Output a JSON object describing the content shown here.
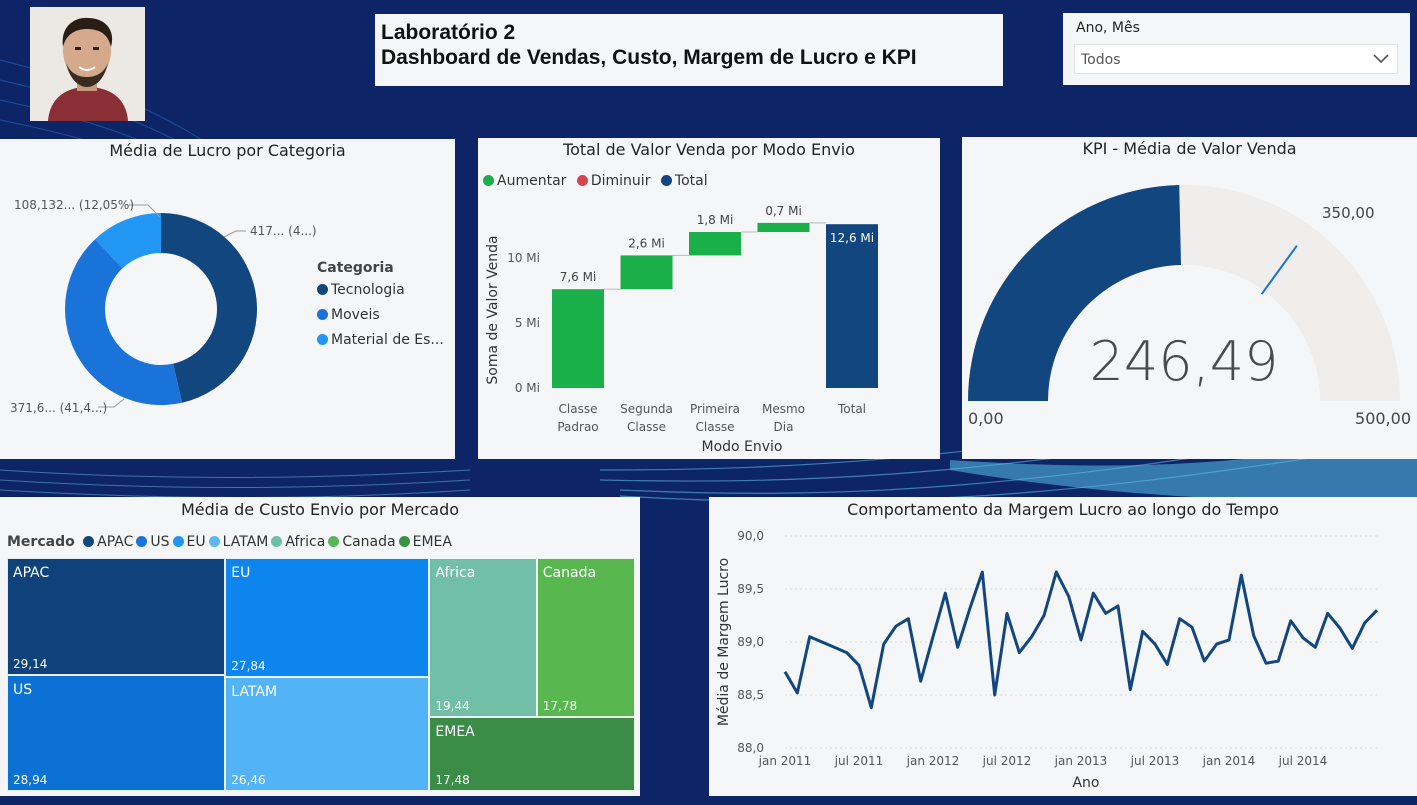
{
  "header": {
    "title_line1": "Laboratório 2",
    "title_line2": "Dashboard de Vendas, Custo, Margem de Lucro e KPI"
  },
  "slicer": {
    "label": "Ano, Mês",
    "value": "Todos",
    "icon": "chevron-down-icon"
  },
  "colors": {
    "background": "#0d2566",
    "panel": "#f5f6f8",
    "navy": "#12467e",
    "blue": "#1a73d9",
    "lightblue": "#2196f3",
    "green": "#1aaf48",
    "red": "#d64550",
    "gauge_fill": "#12467e",
    "gauge_track": "#efeeec"
  },
  "donut": {
    "title": "Média de Lucro por Categoria",
    "legend_title": "Categoria",
    "labels": [
      "108,132... (12,05%)",
      "417... (4...)",
      "371,6... (41,4...)"
    ],
    "chart_data": {
      "type": "pie",
      "title": "Média de Lucro por Categoria",
      "categories": [
        "Tecnologia",
        "Moveis",
        "Material de Es..."
      ],
      "values_percent": [
        46.5,
        41.45,
        12.05
      ],
      "colors": [
        "#12467e",
        "#1a73d9",
        "#2196f3"
      ]
    }
  },
  "waterfall": {
    "title": "Total de Valor Venda por Modo Envio",
    "legend": [
      {
        "label": "Aumentar",
        "color": "#1aaf48"
      },
      {
        "label": "Diminuir",
        "color": "#d64550"
      },
      {
        "label": "Total",
        "color": "#12467e"
      }
    ],
    "ylabel": "Soma de Valor Venda",
    "xlabel": "Modo Envio",
    "yticks": [
      "0 Mi",
      "5 Mi",
      "10 Mi"
    ],
    "chart_data": {
      "type": "bar",
      "subtype": "waterfall",
      "categories": [
        [
          "Classe",
          "Padrao"
        ],
        [
          "Segunda",
          "Classe"
        ],
        [
          "Primeira",
          "Classe"
        ],
        [
          "Mesmo",
          "Dia"
        ],
        [
          "Total"
        ]
      ],
      "values": [
        7.6,
        2.6,
        1.8,
        0.7,
        12.6
      ],
      "value_labels": [
        "7,6 Mi",
        "2,6 Mi",
        "1,8 Mi",
        "0,7 Mi",
        "12,6 Mi"
      ],
      "kinds": [
        "increase",
        "increase",
        "increase",
        "increase",
        "total"
      ],
      "ylim": [
        0,
        13.5
      ],
      "unit": "Mi"
    }
  },
  "gauge": {
    "title": "KPI - Média de Valor Venda",
    "value_text": "246,49",
    "min_text": "0,00",
    "max_text": "500,00",
    "target_text": "350,00",
    "chart_data": {
      "type": "gauge",
      "value": 246.49,
      "min": 0,
      "max": 500,
      "target": 350
    }
  },
  "treemap": {
    "title": "Média de Custo Envio por Mercado",
    "legend_title": "Mercado",
    "legend": [
      {
        "label": "APAC",
        "color": "#12467e"
      },
      {
        "label": "US",
        "color": "#1a73d9"
      },
      {
        "label": "EU",
        "color": "#2196f3"
      },
      {
        "label": "LATAM",
        "color": "#5ab8f5"
      },
      {
        "label": "Africa",
        "color": "#6fbfa6"
      },
      {
        "label": "Canada",
        "color": "#57b757"
      },
      {
        "label": "EMEA",
        "color": "#3d8f47"
      }
    ],
    "tiles": [
      {
        "name": "APAC",
        "label": "29,14",
        "color": "#0f427a"
      },
      {
        "name": "EU",
        "label": "27,84",
        "color": "#0c86ee"
      },
      {
        "name": "US",
        "label": "28,94",
        "color": "#0c71d4"
      },
      {
        "name": "LATAM",
        "label": "26,46",
        "color": "#52b3f6"
      },
      {
        "name": "Africa",
        "label": "19,44",
        "color": "#71bfa7"
      },
      {
        "name": "Canada",
        "label": "17,78",
        "color": "#58b84f"
      },
      {
        "name": "EMEA",
        "label": "17,48",
        "color": "#3b8c46"
      }
    ],
    "chart_data": {
      "type": "treemap",
      "categories": [
        "APAC",
        "US",
        "EU",
        "LATAM",
        "Africa",
        "Canada",
        "EMEA"
      ],
      "values": [
        29.14,
        28.94,
        27.84,
        26.46,
        19.44,
        17.78,
        17.48
      ]
    }
  },
  "line": {
    "title": "Comportamento da Margem Lucro ao longo do Tempo",
    "ylabel": "Média de Margem Lucro",
    "xlabel": "Ano",
    "yticks": [
      "88,0",
      "88,5",
      "89,0",
      "89,5",
      "90,0"
    ],
    "xticks": [
      "jan 2011",
      "jul 2011",
      "jan 2012",
      "jul 2012",
      "jan 2013",
      "jul 2013",
      "jan 2014",
      "jul 2014"
    ],
    "chart_data": {
      "type": "line",
      "x_start": "jan 2011",
      "x_end": "dez 2014",
      "ylim": [
        88.0,
        90.0
      ],
      "values": [
        88.72,
        88.52,
        89.05,
        89.0,
        88.95,
        88.9,
        88.78,
        88.38,
        88.98,
        89.15,
        89.22,
        88.63,
        89.05,
        89.46,
        88.95,
        89.32,
        89.66,
        88.5,
        89.27,
        88.9,
        89.05,
        89.25,
        89.66,
        89.43,
        89.02,
        89.46,
        89.27,
        89.34,
        88.55,
        89.1,
        88.98,
        88.79,
        89.22,
        89.14,
        88.82,
        88.98,
        89.02,
        89.63,
        89.06,
        88.8,
        88.82,
        89.2,
        89.04,
        88.95,
        89.27,
        89.13,
        88.94,
        89.18,
        89.3
      ],
      "color": "#12467e"
    }
  }
}
